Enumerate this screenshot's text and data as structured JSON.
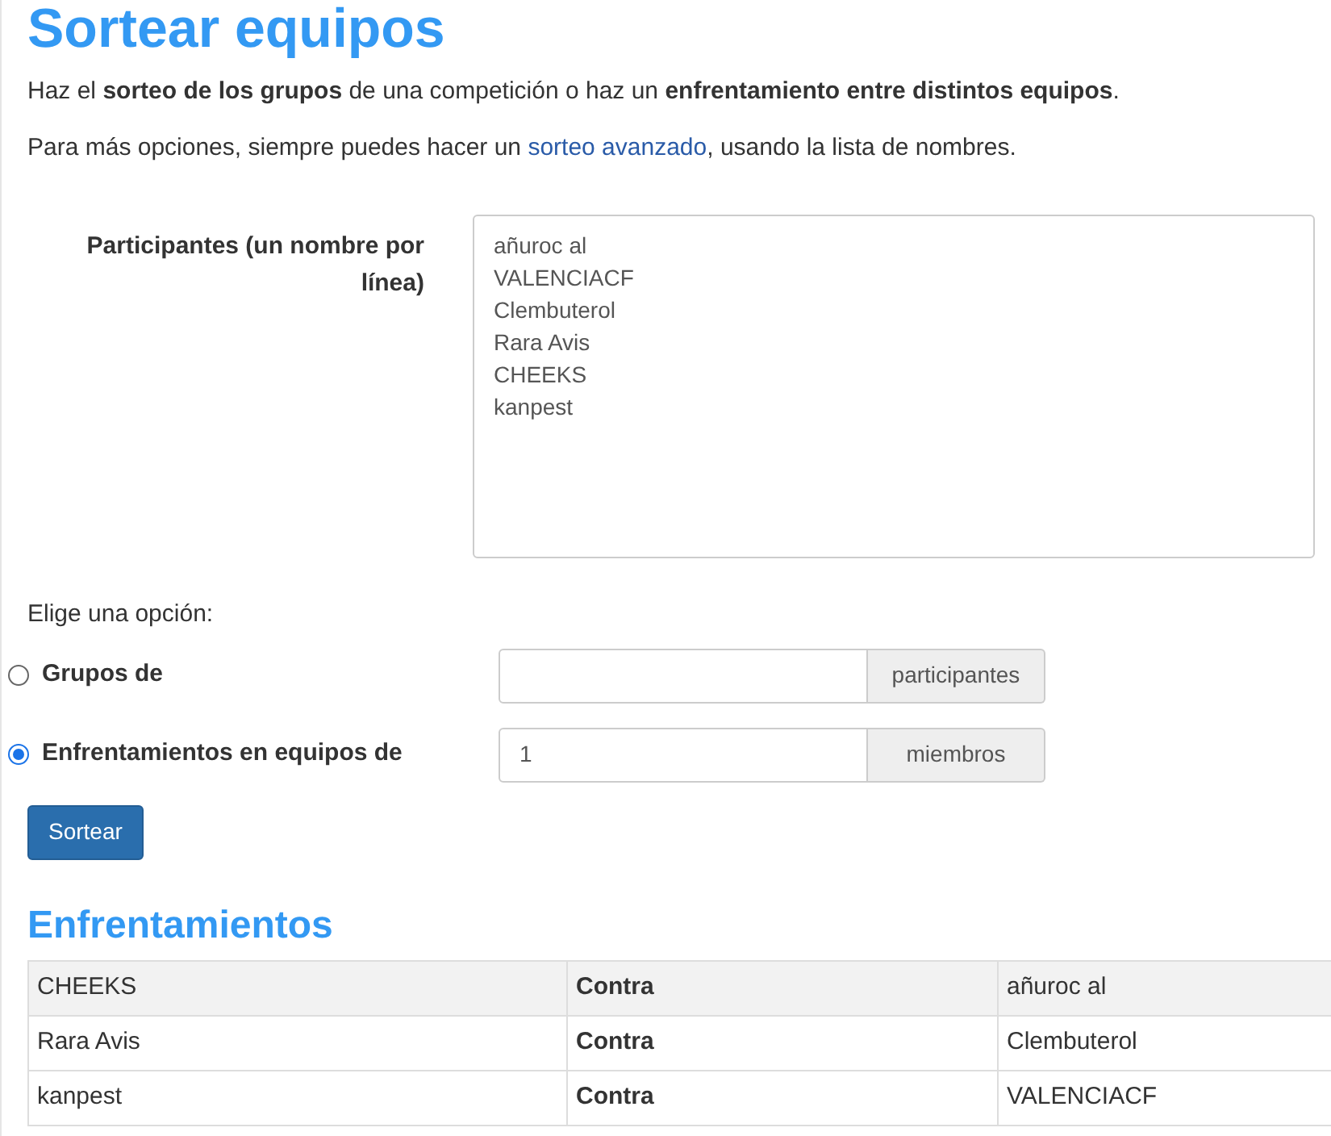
{
  "title": "Sortear equipos",
  "intro": "Haz el **sorteo de los grupos** de una competición o haz un **enfrentamiento entre distintos equipos**.",
  "more": {
    "before": "Para más opciones, siempre puedes hacer un ",
    "link": "sorteo avanzado",
    "after": ", usando la lista de nombres."
  },
  "participants": {
    "label": "Participantes (un nombre por línea)",
    "lines": [
      "añuroc al",
      "VALENCIACF",
      "Clembuterol",
      "Rara Avis",
      "CHEEKS",
      "kanpest"
    ]
  },
  "choose_label": "Elige una opción:",
  "options": [
    {
      "label": "Grupos de",
      "selected": false,
      "addon": "participantes"
    },
    {
      "label": "Enfrentamientos en equipos de",
      "selected": true,
      "value": "1",
      "addon": "miembros"
    }
  ],
  "submit": "Sortear",
  "results": {
    "title": "Enfrentamientos",
    "rows": [
      {
        "left": "CHEEKS",
        "middle": "Contra",
        "right": "añuroc al",
        "shaded": true
      },
      {
        "left": "Rara Avis",
        "middle": "Contra",
        "right": "Clembuterol",
        "shaded": false
      },
      {
        "left": "kanpest",
        "middle": "Contra",
        "right": "VALENCIACF",
        "shaded": false
      }
    ]
  }
}
